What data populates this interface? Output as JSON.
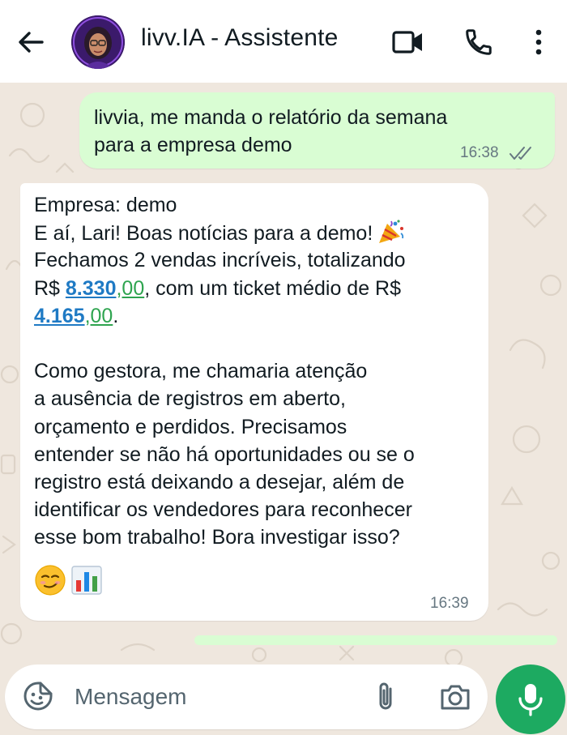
{
  "header": {
    "contact_name": "livv.IA - Assistente",
    "icons": [
      "back-arrow-icon",
      "avatar",
      "video-call-icon",
      "phone-icon",
      "more-vertical-icon"
    ]
  },
  "messages": {
    "outgoing": {
      "text_line1": "livvia, me manda o relatório da semana",
      "text_line2": "para a empresa demo",
      "time": "16:38",
      "status": "read-double-check"
    },
    "incoming": {
      "line1": "Empresa: demo",
      "line2": "E aí, Lari! Boas notícias para a demo!",
      "line3": "Fechamos 2 vendas incríveis, totalizando",
      "line4_prefix": "R$ ",
      "total_int": "8.330",
      "total_dec": ",00",
      "line4_suffix": ", com um ticket médio de R$",
      "ticket_int": "4.165",
      "ticket_dec": ",00",
      "line5_suffix": ".",
      "para2_line1": "Como gestora, me chamaria atenção",
      "para2_line2": "a ausência de registros em aberto,",
      "para2_line3": "orçamento e perdidos. Precisamos",
      "para2_line4": "entender se não há oportunidades ou se o",
      "para2_line5": "registro está deixando a desejar, além de",
      "para2_line6": "identificar os vendedores para reconhecer",
      "para2_line7": "esse bom trabalho! Bora investigar isso?",
      "emojis": [
        "party-popper",
        "smirking-face",
        "bar-chart"
      ],
      "time": "16:39"
    }
  },
  "composer": {
    "placeholder": "Mensagem",
    "icons": [
      "sticker-icon",
      "paperclip-icon",
      "camera-icon",
      "mic-icon"
    ]
  },
  "colors": {
    "outgoing_bubble": "#d9fdd3",
    "incoming_bubble": "#ffffff",
    "chat_background": "#efe7de",
    "mic_button": "#1daa61",
    "currency_integer": "#1f7ac4",
    "currency_decimal": "#2ea44f"
  }
}
